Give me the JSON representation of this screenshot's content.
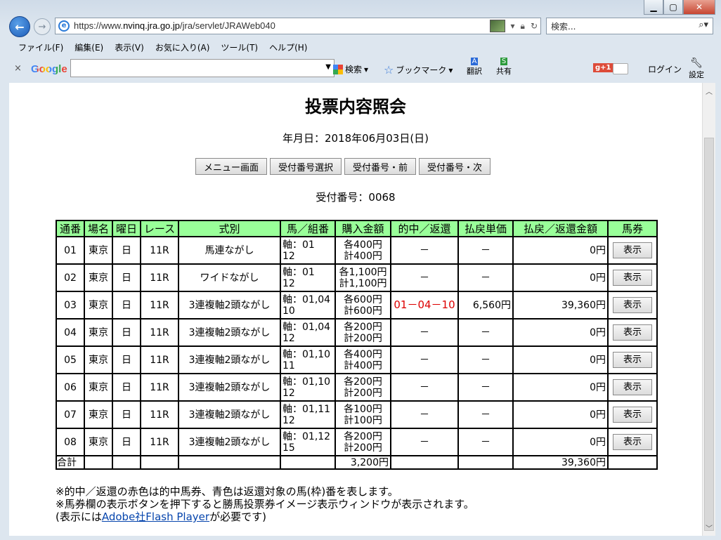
{
  "browser": {
    "url_prefix": "https://www.",
    "url_domain": "nvinq.jra.go.jp",
    "url_path": "/jra/servlet/JRAWeb040",
    "search_placeholder": "検索...",
    "menu": [
      "ファイル(F)",
      "編集(E)",
      "表示(V)",
      "お気に入り(A)",
      "ツール(T)",
      "ヘルプ(H)"
    ],
    "toolbar": {
      "close": "×",
      "google": "Google",
      "search": "検索",
      "bookmark": "ブックマーク",
      "translate": "翻訳",
      "share": "共有",
      "gplus": "g+1",
      "login": "ログイン",
      "settings": "設定"
    }
  },
  "page": {
    "title": "投票内容照会",
    "date": "年月日：2018年06月03日(日)",
    "buttons": [
      "メニュー画面",
      "受付番号選択",
      "受付番号・前",
      "受付番号・次"
    ],
    "receipt": "受付番号：0068",
    "headers": [
      "通番",
      "場名",
      "曜日",
      "レース",
      "式別",
      "馬／組番",
      "購入金額",
      "的中／返還",
      "払戻単価",
      "払戻／返還金額",
      "馬券"
    ],
    "rows": [
      {
        "no": "01",
        "place": "東京",
        "day": "日",
        "race": "11R",
        "type": "馬連ながし",
        "comb1": "軸：01",
        "comb2": "12",
        "amt1": "各400円",
        "amt2": "計400円",
        "hit": "－",
        "unit": "－",
        "payout": "0円",
        "ticket": "表示"
      },
      {
        "no": "02",
        "place": "東京",
        "day": "日",
        "race": "11R",
        "type": "ワイドながし",
        "comb1": "軸：01",
        "comb2": "12",
        "amt1": "各1,100円",
        "amt2": "計1,100円",
        "hit": "－",
        "unit": "－",
        "payout": "0円",
        "ticket": "表示"
      },
      {
        "no": "03",
        "place": "東京",
        "day": "日",
        "race": "11R",
        "type": "3連複軸2頭ながし",
        "comb1": "軸：01,04",
        "comb2": "10",
        "amt1": "各600円",
        "amt2": "計600円",
        "hit": "01－04－10",
        "unit": "6,560円",
        "payout": "39,360円",
        "ticket": "表示"
      },
      {
        "no": "04",
        "place": "東京",
        "day": "日",
        "race": "11R",
        "type": "3連複軸2頭ながし",
        "comb1": "軸：01,04",
        "comb2": "12",
        "amt1": "各200円",
        "amt2": "計200円",
        "hit": "－",
        "unit": "－",
        "payout": "0円",
        "ticket": "表示"
      },
      {
        "no": "05",
        "place": "東京",
        "day": "日",
        "race": "11R",
        "type": "3連複軸2頭ながし",
        "comb1": "軸：01,10",
        "comb2": "11",
        "amt1": "各400円",
        "amt2": "計400円",
        "hit": "－",
        "unit": "－",
        "payout": "0円",
        "ticket": "表示"
      },
      {
        "no": "06",
        "place": "東京",
        "day": "日",
        "race": "11R",
        "type": "3連複軸2頭ながし",
        "comb1": "軸：01,10",
        "comb2": "12",
        "amt1": "各200円",
        "amt2": "計200円",
        "hit": "－",
        "unit": "－",
        "payout": "0円",
        "ticket": "表示"
      },
      {
        "no": "07",
        "place": "東京",
        "day": "日",
        "race": "11R",
        "type": "3連複軸2頭ながし",
        "comb1": "軸：01,11",
        "comb2": "12",
        "amt1": "各100円",
        "amt2": "計100円",
        "hit": "－",
        "unit": "－",
        "payout": "0円",
        "ticket": "表示"
      },
      {
        "no": "08",
        "place": "東京",
        "day": "日",
        "race": "11R",
        "type": "3連複軸2頭ながし",
        "comb1": "軸：01,12",
        "comb2": "15",
        "amt1": "各200円",
        "amt2": "計200円",
        "hit": "－",
        "unit": "－",
        "payout": "0円",
        "ticket": "表示"
      }
    ],
    "total": {
      "label": "合計",
      "amount": "3,200円",
      "payout": "39,360円"
    },
    "notes": {
      "line1": "※的中／返還の赤色は的中馬券、青色は返還対象の馬(枠)番を表します。",
      "line2": "※馬券欄の表示ボタンを押下すると勝馬投票券イメージ表示ウィンドウが表示されます。",
      "line3_pre": "(表示には",
      "line3_link": "Adobe社Flash Player",
      "line3_post": "が必要です)"
    }
  },
  "colors": {
    "header_bg": "#99ff99",
    "hit_red": "#dd0000",
    "link": "#0645ad"
  }
}
